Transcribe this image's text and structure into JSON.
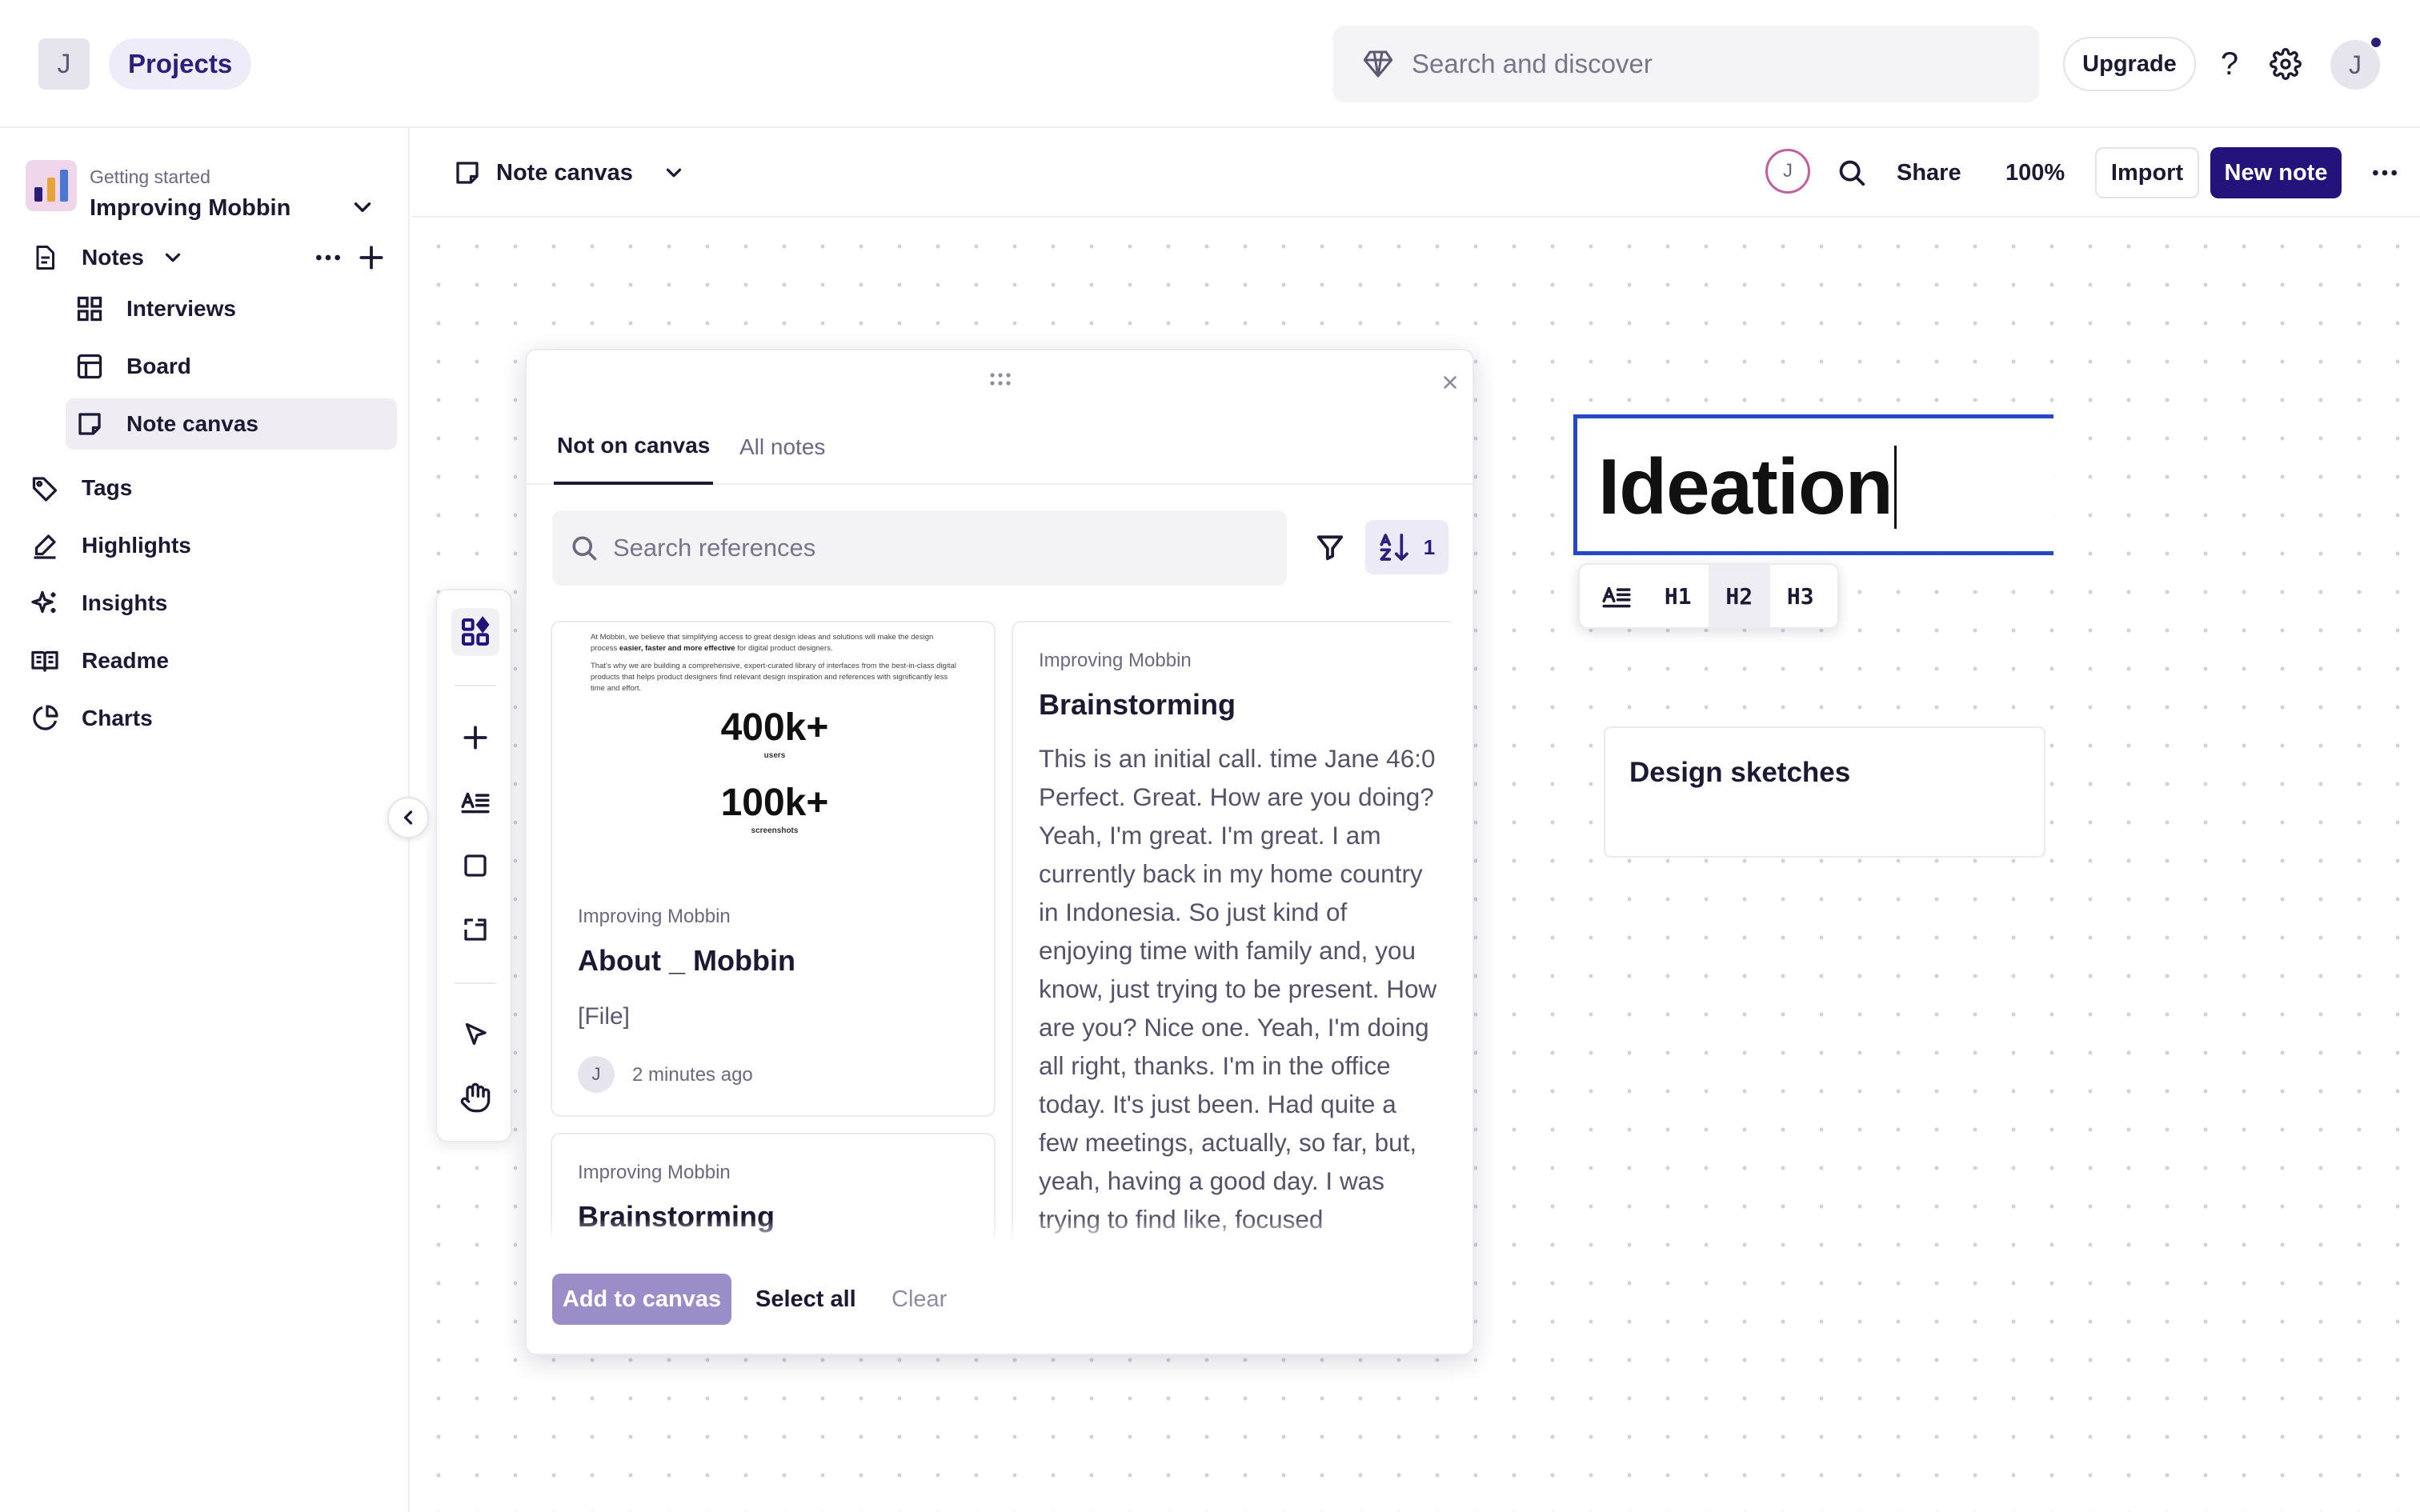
{
  "topbar": {
    "workspace_initial": "J",
    "projects_label": "Projects",
    "search_placeholder": "Search and discover",
    "upgrade_label": "Upgrade",
    "help_label": "?",
    "user_initial": "J"
  },
  "sidebar": {
    "project_subtitle": "Getting started",
    "project_name": "Improving Mobbin",
    "notes_label": "Notes",
    "note_views": [
      {
        "label": "Interviews",
        "icon": "grid-icon"
      },
      {
        "label": "Board",
        "icon": "board-icon"
      },
      {
        "label": "Note canvas",
        "icon": "note-icon",
        "active": true
      }
    ],
    "items": [
      {
        "label": "Tags",
        "icon": "tag-icon"
      },
      {
        "label": "Highlights",
        "icon": "highlighter-icon"
      },
      {
        "label": "Insights",
        "icon": "sparkle-icon"
      },
      {
        "label": "Readme",
        "icon": "book-icon"
      },
      {
        "label": "Charts",
        "icon": "pie-chart-icon"
      }
    ]
  },
  "canvas_header": {
    "view_label": "Note canvas",
    "collaborator_initial": "J",
    "share_label": "Share",
    "zoom": "100%",
    "import_label": "Import",
    "new_note_label": "New note"
  },
  "ref_panel": {
    "tabs": [
      "Not on canvas",
      "All notes"
    ],
    "search_placeholder": "Search references",
    "sort_count": "1",
    "cards": {
      "about": {
        "thumb_para1": "At Mobbin, we believe that simplifying access to great design ideas and solutions will make the design process",
        "thumb_para1_bold": "easier, faster and more effective",
        "thumb_para1_end": "for digital product designers.",
        "thumb_para2": "That's why we are building a comprehensive, expert-curated library of interfaces from the best-in-class digital products that helps product designers find relevant design inspiration and references with significantly less time and effort.",
        "stat1_value": "400k+",
        "stat1_label": "users",
        "stat2_value": "100k+",
        "stat2_label": "screenshots",
        "project": "Improving Mobbin",
        "title": "About _ Mobbin",
        "file_label": "[File]",
        "author_initial": "J",
        "time": "2 minutes ago"
      },
      "brainstorm_1": {
        "project": "Improving Mobbin",
        "title": "Brainstorming",
        "text": "This is an initial call. time Jane 46:0 Perfect. Great. How are you doing? Yeah, I'm great. I'm great. I am currently back in my home country in Indonesia. So just kind of enjoying time with family and, you know, just trying to be present. How are you? Nice one. Yeah, I'm doing all right, thanks. I'm in the office today. It's just been. Had quite a few meetings, actually, so far, but, yeah, having a good day. I was trying to find like, focused"
      },
      "brainstorm_2": {
        "project": "Improving Mobbin",
        "title": "Brainstorming"
      }
    },
    "footer": {
      "add_label": "Add to canvas",
      "select_all_label": "Select all",
      "clear_label": "Clear"
    }
  },
  "canvas": {
    "heading_text": "Ideation",
    "heading_toolbar": [
      "H1",
      "H2",
      "H3"
    ],
    "heading_active": "H2",
    "sketch_card_title": "Design sketches"
  },
  "colors": {
    "brand": "#24137a",
    "accent_blue": "#2548c4",
    "muted_text": "#6b6980"
  }
}
